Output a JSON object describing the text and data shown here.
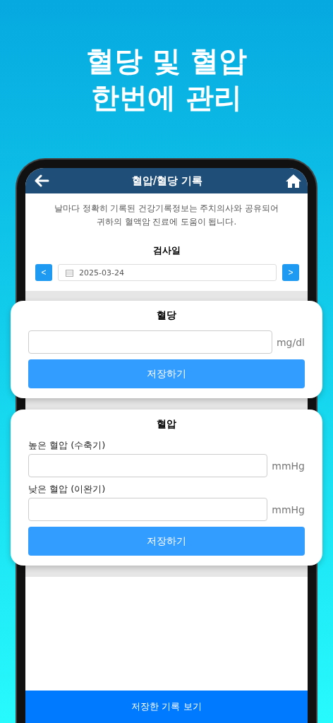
{
  "headline": [
    "혈당 및 혈압",
    "한번에 관리"
  ],
  "app_bar": {
    "title": "혈압/혈당 기록"
  },
  "intro": [
    "날마다 정확히 기록된 건강기록정보는 주치의사와 공유되어",
    "귀하의 혈액암 진료에 도움이 됩니다."
  ],
  "date_picker": {
    "label": "검사일",
    "prev": "<",
    "value": "2025-03-24",
    "next": ">"
  },
  "cards": [
    {
      "title": "혈당",
      "fields": [
        {
          "unit": "mg/dl"
        }
      ],
      "button": "저장하기"
    },
    {
      "title": "혈압",
      "fields": [
        {
          "label": "높은 혈압 (수축기)",
          "unit": "mmHg"
        },
        {
          "label": "낮은 혈압 (이완기)",
          "unit": "mmHg"
        }
      ],
      "button": "저장하기"
    }
  ],
  "bottom_button": "저장한 기록 보기"
}
